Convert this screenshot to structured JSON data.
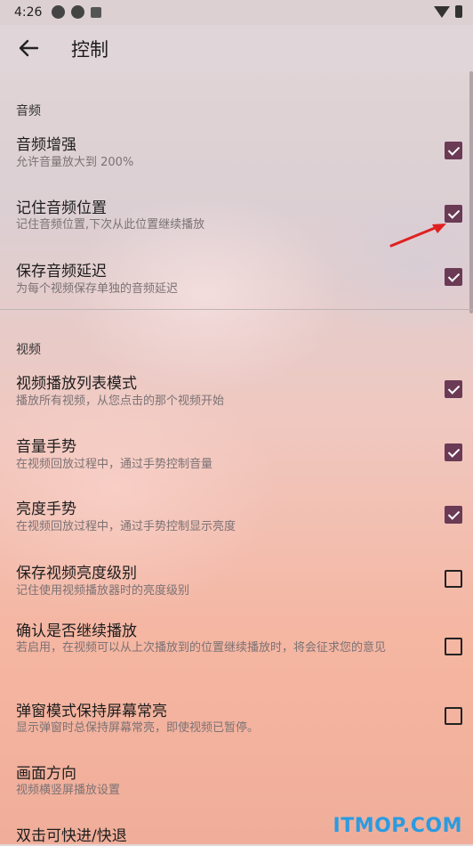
{
  "status_bar": {
    "time": "4:26"
  },
  "app_bar": {
    "title": "控制"
  },
  "sections": [
    {
      "title": "音频",
      "items": [
        {
          "title": "音频增强",
          "subtitle": "允许音量放大到 200%",
          "checked": true
        },
        {
          "title": "记住音频位置",
          "subtitle": "记住音频位置,下次从此位置继续播放",
          "checked": true
        },
        {
          "title": "保存音频延迟",
          "subtitle": "为每个视频保存单独的音频延迟",
          "checked": true
        }
      ]
    },
    {
      "title": "视频",
      "items": [
        {
          "title": "视频播放列表模式",
          "subtitle": "播放所有视频，从您点击的那个视频开始",
          "checked": true
        },
        {
          "title": "音量手势",
          "subtitle": "在视频回放过程中，通过手势控制音量",
          "checked": true
        },
        {
          "title": "亮度手势",
          "subtitle": "在视频回放过程中，通过手势控制显示亮度",
          "checked": true
        },
        {
          "title": "保存视频亮度级别",
          "subtitle": "记住使用视频播放器时的亮度级别",
          "checked": false
        },
        {
          "title": "确认是否继续播放",
          "subtitle": "若启用，在视频可以从上次播放到的位置继续播放时，将会征求您的意见",
          "checked": false
        },
        {
          "title": "弹窗模式保持屏幕常亮",
          "subtitle": "显示弹窗时总保持屏幕常亮，即使视频已暂停。",
          "checked": false
        },
        {
          "title": "画面方向",
          "subtitle": "视频横竖屏播放设置"
        },
        {
          "title": "双击可快进/快退"
        }
      ]
    }
  ],
  "watermark": "ITMOP.COM",
  "colors": {
    "accent": "#6b3a55",
    "annotation_arrow": "#e02020",
    "watermark": "#2b9be0"
  }
}
